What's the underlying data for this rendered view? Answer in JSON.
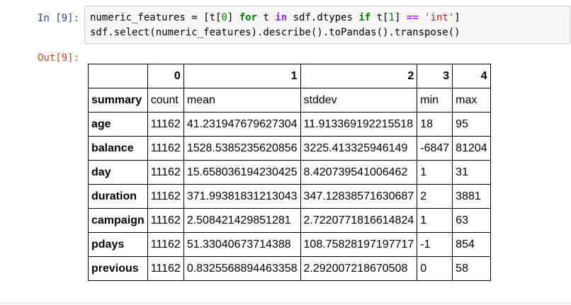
{
  "cell": {
    "in_prompt": "In [9]:",
    "out_prompt": "Out[9]:",
    "code_line1": {
      "a": "numeric_features = [t[",
      "n0": "0",
      "b": "] ",
      "for": "for",
      "c": " t ",
      "in": "in",
      "d": " sdf.dtypes ",
      "if": "if",
      "e": " t[",
      "n1": "1",
      "f": "] ",
      "eq": "==",
      "g": " ",
      "str": "'int'",
      "h": "]"
    },
    "code_line2": "sdf.select(numeric_features).describe().toPandas().transpose()"
  },
  "table": {
    "columns": [
      "",
      "0",
      "1",
      "2",
      "3",
      "4"
    ],
    "rows": [
      {
        "index": "summary",
        "values": [
          "count",
          "mean",
          "stddev",
          "min",
          "max"
        ]
      },
      {
        "index": "age",
        "values": [
          "11162",
          "41.231947679627304",
          "11.913369192215518",
          "18",
          "95"
        ]
      },
      {
        "index": "balance",
        "values": [
          "11162",
          "1528.5385235620856",
          "3225.413325946149",
          "-6847",
          "81204"
        ]
      },
      {
        "index": "day",
        "values": [
          "11162",
          "15.658036194230425",
          "8.420739541006462",
          "1",
          "31"
        ]
      },
      {
        "index": "duration",
        "values": [
          "11162",
          "371.99381831213043",
          "347.12838571630687",
          "2",
          "3881"
        ]
      },
      {
        "index": "campaign",
        "values": [
          "11162",
          "2.508421429851281",
          "2.7220771816614824",
          "1",
          "63"
        ]
      },
      {
        "index": "pdays",
        "values": [
          "11162",
          "51.33040673714388",
          "108.75828197197717",
          "-1",
          "854"
        ]
      },
      {
        "index": "previous",
        "values": [
          "11162",
          "0.8325568894463358",
          "2.292007218670508",
          "0",
          "58"
        ]
      }
    ]
  }
}
